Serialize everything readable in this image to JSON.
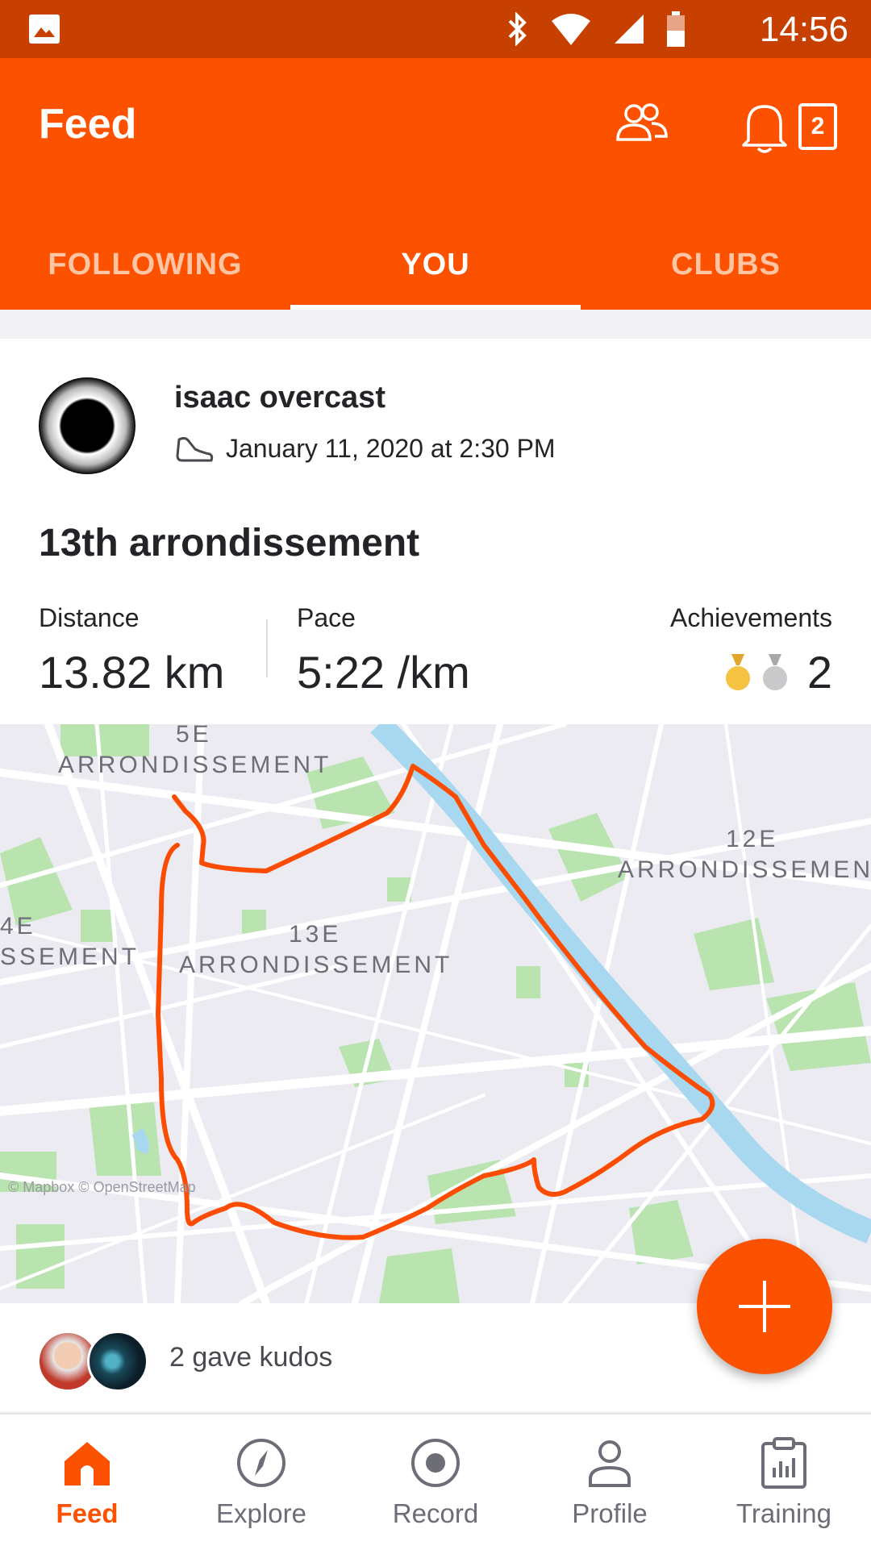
{
  "status_bar": {
    "time": "14:56"
  },
  "header": {
    "title": "Feed",
    "notification_count": "2",
    "tabs": [
      {
        "label": "FOLLOWING",
        "active": false
      },
      {
        "label": "YOU",
        "active": true
      },
      {
        "label": "CLUBS",
        "active": false
      }
    ]
  },
  "activity": {
    "athlete": "isaac overcast",
    "datetime": "January 11, 2020 at 2:30 PM",
    "sport_icon": "shoe-icon",
    "title": "13th arrondissement",
    "stats": {
      "distance_label": "Distance",
      "distance_value": "13.82 km",
      "pace_label": "Pace",
      "pace_value": "5:22 /km",
      "achievements_label": "Achievements",
      "achievements_count": "2"
    },
    "map": {
      "labels": {
        "arr5_num": "5E",
        "arr5_name": "ARRONDISSEMENT",
        "arr12_num": "12E",
        "arr12_name": "ARRONDISSEMEN",
        "arr13_num": "13E",
        "arr13_name": "ARRONDISSEMENT",
        "arr14_num": "4E",
        "arr14_name": "SSEMENT"
      },
      "attribution": "© Mapbox © OpenStreetMap",
      "route_color": "#fc4c02"
    },
    "kudos_text": "2 gave kudos"
  },
  "bottom_nav": [
    {
      "label": "Feed",
      "icon": "home-icon",
      "active": true
    },
    {
      "label": "Explore",
      "icon": "compass-icon",
      "active": false
    },
    {
      "label": "Record",
      "icon": "record-icon",
      "active": false
    },
    {
      "label": "Profile",
      "icon": "person-icon",
      "active": false
    },
    {
      "label": "Training",
      "icon": "clipboard-chart-icon",
      "active": false
    }
  ],
  "colors": {
    "brand": "#fc5200",
    "status_bar": "#c84000",
    "gold": "#f5c242",
    "silver": "#c9c9cc"
  }
}
